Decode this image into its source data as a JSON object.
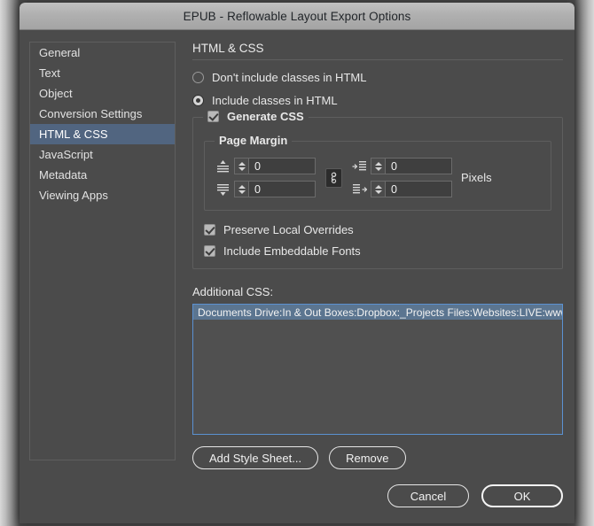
{
  "window": {
    "title": "EPUB - Reflowable Layout Export Options"
  },
  "sidebar": {
    "items": [
      {
        "label": "General",
        "selected": false
      },
      {
        "label": "Text",
        "selected": false
      },
      {
        "label": "Object",
        "selected": false
      },
      {
        "label": "Conversion Settings",
        "selected": false
      },
      {
        "label": "HTML & CSS",
        "selected": true
      },
      {
        "label": "JavaScript",
        "selected": false
      },
      {
        "label": "Metadata",
        "selected": false
      },
      {
        "label": "Viewing Apps",
        "selected": false
      }
    ]
  },
  "pane": {
    "title": "HTML & CSS",
    "radios": [
      {
        "label": "Don't include classes in HTML",
        "checked": false
      },
      {
        "label": "Include classes in HTML",
        "checked": true
      }
    ],
    "generate_css": {
      "label": "Generate CSS",
      "checked": true,
      "page_margin": {
        "legend": "Page Margin",
        "units": "Pixels",
        "link_icon": "chain-link-icon",
        "fields": [
          {
            "icon": "margin-top-icon",
            "value": "0"
          },
          {
            "icon": "margin-bottom-icon",
            "value": "0"
          },
          {
            "icon": "margin-left-icon",
            "value": "0"
          },
          {
            "icon": "margin-right-icon",
            "value": "0"
          }
        ]
      },
      "checkboxes": [
        {
          "label": "Preserve Local Overrides",
          "checked": true
        },
        {
          "label": "Include Embeddable Fonts",
          "checked": true
        }
      ]
    },
    "additional_css": {
      "title": "Additional CSS:",
      "entries": [
        {
          "path": "Documents Drive:In & Out Boxes:Dropbox:_Projects Files:Websites:LIVE:www.pariahrocks...",
          "selected": true
        }
      ],
      "add_button": "Add Style Sheet...",
      "remove_button": "Remove"
    }
  },
  "footer": {
    "cancel": "Cancel",
    "ok": "OK"
  },
  "colors": {
    "dialog_bg": "#4b4b4b",
    "titlebar": "#b0b0b0",
    "selection_blue": "#516580",
    "focus_border": "#5b91d1",
    "list_selection": "#5b7590"
  }
}
